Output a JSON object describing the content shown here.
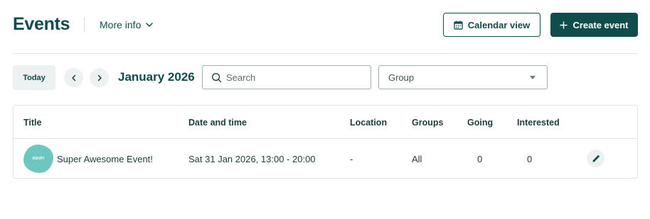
{
  "header": {
    "title": "Events",
    "more_info_label": "More info",
    "calendar_view_label": "Calendar view",
    "create_event_label": "Create event"
  },
  "toolbar": {
    "today_label": "Today",
    "month_label": "January 2026",
    "search_placeholder": "Search",
    "group_select_value": "Group"
  },
  "table": {
    "columns": [
      "Title",
      "Date and time",
      "Location",
      "Groups",
      "Going",
      "Interested"
    ],
    "rows": [
      {
        "avatar_text": "RSVP!",
        "title": "Super Awesome Event!",
        "date_time": "Sat 31 Jan 2026, 13:00 - 20:00",
        "location": "-",
        "groups": "All",
        "going": "0",
        "interested": "0"
      }
    ]
  },
  "colors": {
    "brand": "#0e4d4b",
    "avatar": "#6ec6c0",
    "border": "#dfe5e4"
  },
  "icons": [
    "chevron-down-icon",
    "calendar-icon",
    "plus-icon",
    "chevron-left-icon",
    "chevron-right-icon",
    "search-icon",
    "pencil-icon"
  ]
}
